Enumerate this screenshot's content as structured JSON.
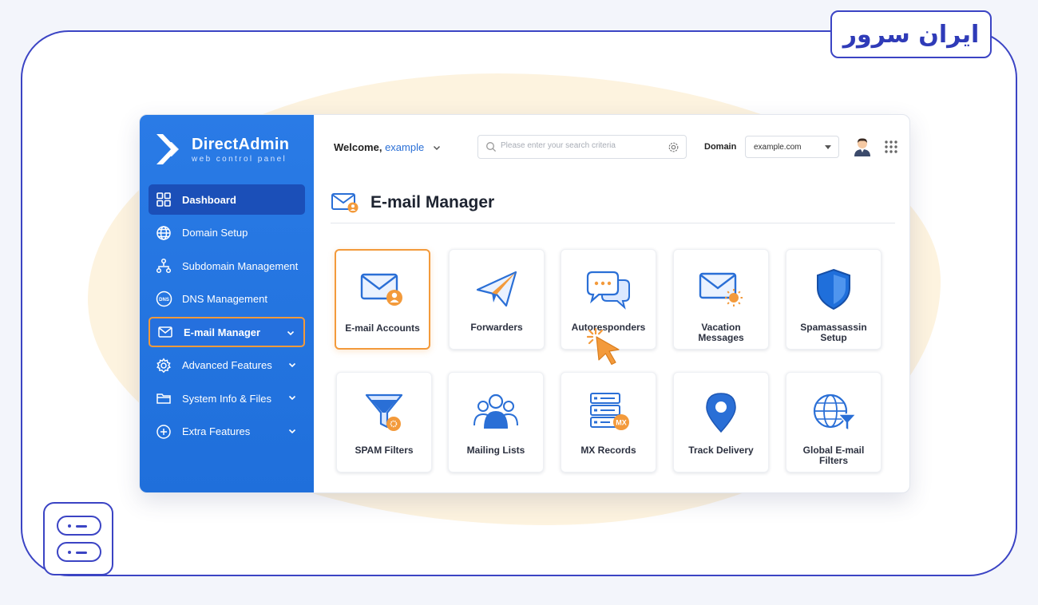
{
  "brand": {
    "badge_text": "ایران سرور"
  },
  "app": {
    "logo_name": "DirectAdmin",
    "logo_tagline": "web control panel"
  },
  "sidebar": {
    "items": [
      {
        "label": "Dashboard",
        "icon": "dashboard-icon"
      },
      {
        "label": "Domain Setup",
        "icon": "globe-icon"
      },
      {
        "label": "Subdomain Management",
        "icon": "sitemap-icon"
      },
      {
        "label": "DNS Management",
        "icon": "dns-icon"
      },
      {
        "label": "E-mail Manager",
        "icon": "envelope-icon"
      },
      {
        "label": "Advanced Features",
        "icon": "gear-icon"
      },
      {
        "label": "System Info & Files",
        "icon": "folder-icon"
      },
      {
        "label": "Extra Features",
        "icon": "plus-circle-icon"
      }
    ]
  },
  "header": {
    "welcome_label": "Welcome,",
    "username": "example",
    "search_placeholder": "Please enter your search criteria",
    "domain_label": "Domain",
    "domain_value": "example.com"
  },
  "page": {
    "title": "E-mail Manager"
  },
  "cards": [
    {
      "label": "E-mail Accounts",
      "icon": "email-accounts-icon"
    },
    {
      "label": "Forwarders",
      "icon": "paper-plane-icon"
    },
    {
      "label": "Autoresponders",
      "icon": "chat-bubbles-icon"
    },
    {
      "label": "Vacation Messages",
      "icon": "envelope-sun-icon"
    },
    {
      "label": "Spamassassin Setup",
      "icon": "shield-icon"
    },
    {
      "label": "SPAM Filters",
      "icon": "funnel-icon"
    },
    {
      "label": "Mailing Lists",
      "icon": "users-icon"
    },
    {
      "label": "MX Records",
      "icon": "server-mx-icon"
    },
    {
      "label": "Track Delivery",
      "icon": "map-pin-icon"
    },
    {
      "label": "Global E-mail Filters",
      "icon": "globe-filter-icon"
    }
  ],
  "mx_badge": "MX",
  "dns_badge": "DNS",
  "colors": {
    "sidebar": "#2a7be6",
    "accent": "#f39a3b",
    "frame": "#3b44c4",
    "icon_blue": "#2a6fd6"
  }
}
